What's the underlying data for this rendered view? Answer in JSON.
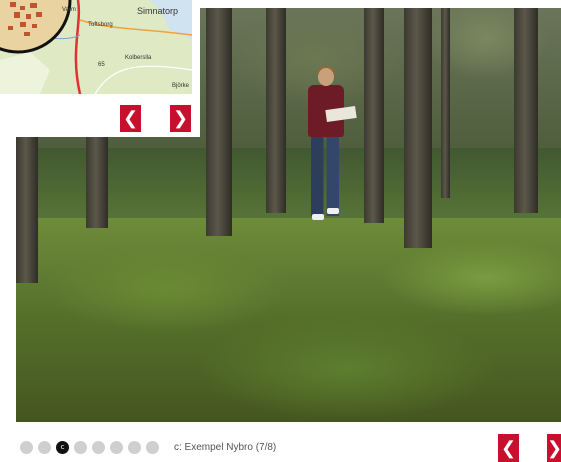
{
  "map": {
    "labels": [
      "Varm",
      "Toftsborg",
      "Simnatorp",
      "Kolberslla",
      "Björke",
      "65"
    ],
    "prev_glyph": "❮",
    "next_glyph": "❯",
    "colors": {
      "water": "#cfe3f0",
      "land": "#dfe9c4",
      "road": "#e0322f",
      "ring": "#111111"
    }
  },
  "slideshow": {
    "dots": [
      "",
      "",
      "c",
      "",
      "",
      "",
      "",
      ""
    ],
    "active_index": 2,
    "caption": "c: Exempel Nybro (7/8)",
    "prev_glyph": "❮",
    "next_glyph": "❯",
    "accent_color": "#c8102e"
  }
}
